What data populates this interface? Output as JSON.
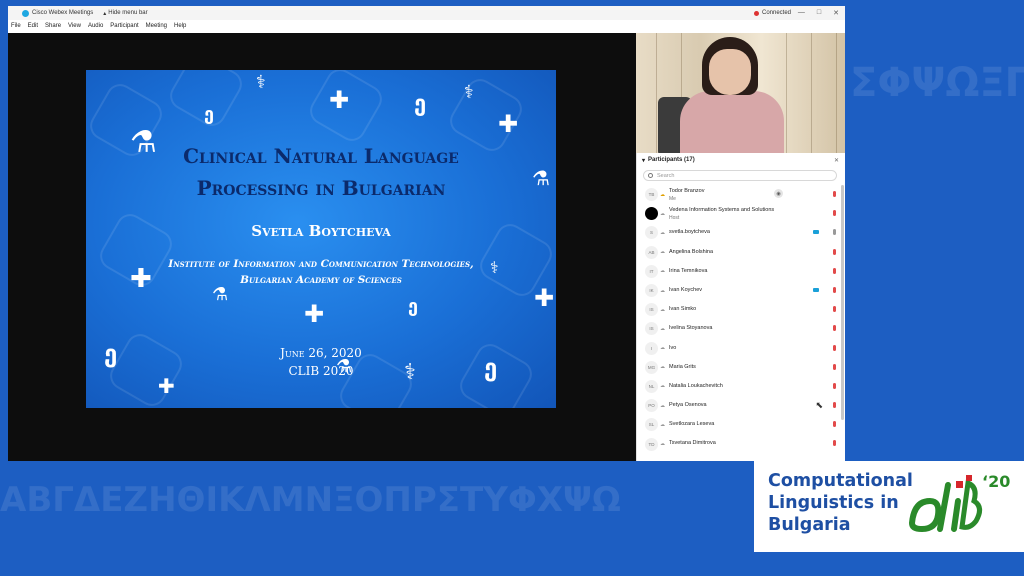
{
  "window": {
    "app_title": "Cisco Webex Meetings",
    "hide_menu_bar": "Hide menu bar",
    "connection_status": "Connected",
    "min_icon": "—",
    "max_icon": "□",
    "close_icon": "✕"
  },
  "menu": [
    "File",
    "Edit",
    "Share",
    "View",
    "Audio",
    "Participant",
    "Meeting",
    "Help"
  ],
  "slide": {
    "title_line1": "Clinical Natural Language",
    "title_line2": "Processing in Bulgarian",
    "author": "Svetla Boytcheva",
    "institute_line1": "Institute of Information and Communication Technologies,",
    "institute_line2": "Bulgarian Academy of Sciences",
    "date": "June 26, 2020",
    "event": "CLIB 2020"
  },
  "participants": {
    "header": "Participants (17)",
    "close": "✕",
    "search_placeholder": "Search",
    "list": [
      {
        "initials": "TB",
        "name": "Todor Branzov",
        "role": "Me"
      },
      {
        "initials": "",
        "name": "Vedena Information Systems and Solutions",
        "role": "Host"
      },
      {
        "initials": "S",
        "name": "svetla.boytcheva",
        "role": ""
      },
      {
        "initials": "AB",
        "name": "Angelina Bolshina",
        "role": ""
      },
      {
        "initials": "IT",
        "name": "Irina Temnikova",
        "role": ""
      },
      {
        "initials": "IK",
        "name": "Ivan Koychev",
        "role": ""
      },
      {
        "initials": "IS",
        "name": "Ivan Simko",
        "role": ""
      },
      {
        "initials": "IS",
        "name": "Ivelina Stoyanova",
        "role": ""
      },
      {
        "initials": "I",
        "name": "Ivo",
        "role": ""
      },
      {
        "initials": "MG",
        "name": "Maria Grits",
        "role": ""
      },
      {
        "initials": "NL",
        "name": "Natalia Loukachevitch",
        "role": ""
      },
      {
        "initials": "PO",
        "name": "Petya Osenova",
        "role": ""
      },
      {
        "initials": "SL",
        "name": "Svetlozara Leseva",
        "role": ""
      },
      {
        "initials": "TD",
        "name": "Tsvetana Dimitrova",
        "role": ""
      }
    ]
  },
  "logo": {
    "line1": "Computational",
    "line2": "Linguistics in",
    "line3": "Bulgaria",
    "year": "‘20"
  },
  "colors": {
    "background": "#1d5ec2",
    "slide_blue": "#1a6fd6",
    "slide_title": "#0b2a6b",
    "logo_blue": "#1e4fa3",
    "logo_green": "#2a8a2a"
  }
}
